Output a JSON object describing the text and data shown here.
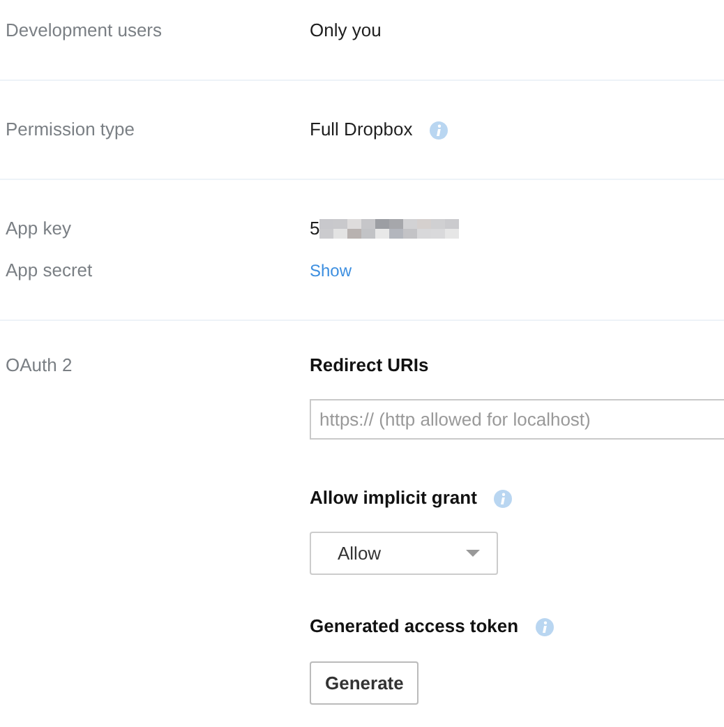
{
  "sections": [
    {
      "rows": [
        {
          "kind": "text",
          "label": "Development users",
          "value": "Only you"
        }
      ]
    },
    {
      "rows": [
        {
          "kind": "text",
          "label": "Permission type",
          "value": "Full Dropbox",
          "info": true
        }
      ]
    },
    {
      "rows": [
        {
          "kind": "redacted",
          "label": "App key",
          "value": "5"
        },
        {
          "kind": "link",
          "label": "App secret",
          "value": "Show"
        }
      ]
    }
  ],
  "oauth": {
    "label": "OAuth 2",
    "redirect": {
      "heading": "Redirect URIs",
      "placeholder": "https:// (http allowed for localhost)"
    },
    "implicit": {
      "heading": "Allow implicit grant",
      "info": true,
      "value": "Allow"
    },
    "token": {
      "heading": "Generated access token",
      "info": true,
      "button": "Generate"
    }
  }
}
